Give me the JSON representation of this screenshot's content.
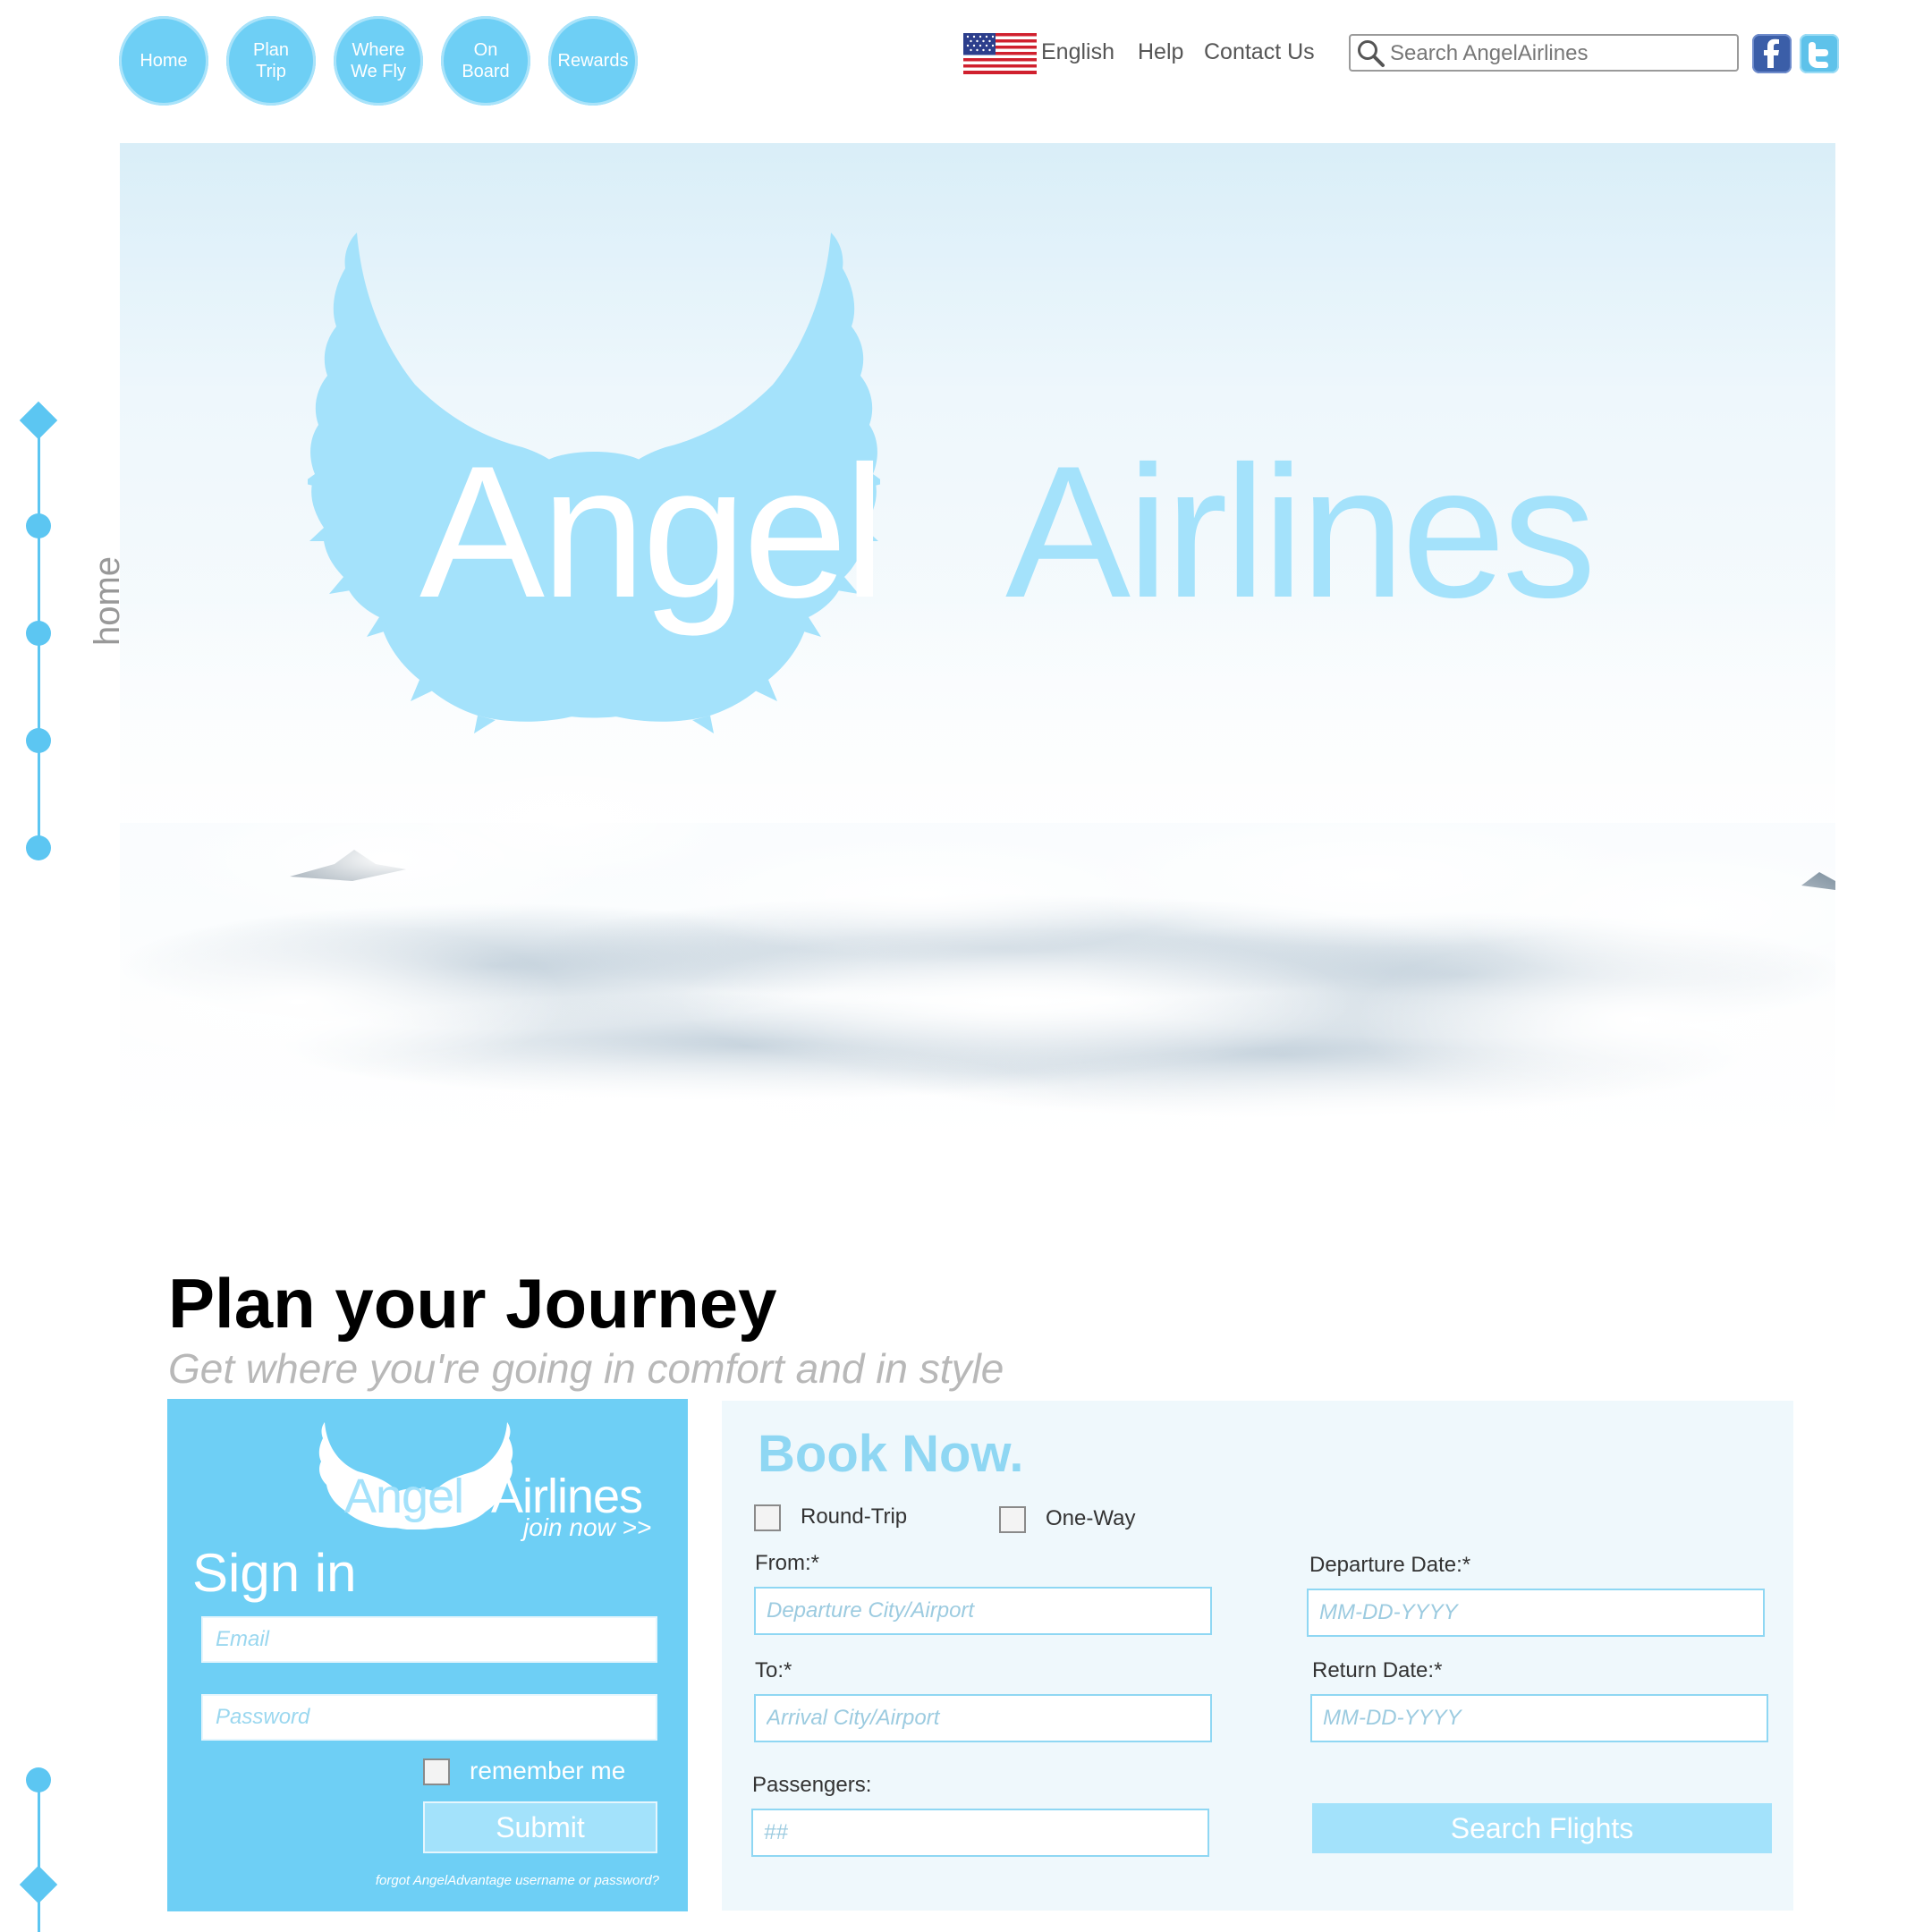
{
  "nav": {
    "items": [
      {
        "line1": "Home",
        "line2": ""
      },
      {
        "line1": "Plan",
        "line2": "Trip"
      },
      {
        "line1": "Where",
        "line2": "We Fly"
      },
      {
        "line1": "On",
        "line2": "Board"
      },
      {
        "line1": "Rewards",
        "line2": ""
      }
    ]
  },
  "utility": {
    "language": "English",
    "help": "Help",
    "contact": "Contact Us",
    "search_placeholder": "Search AngelAirlines"
  },
  "hero": {
    "logo_word_1": "Angel",
    "logo_word_2": "Airlines"
  },
  "side": {
    "section_label": "home"
  },
  "journey": {
    "title": "Plan your Journey",
    "subtitle": "Get where you're going in comfort and in style"
  },
  "signin": {
    "logo_word_1": "Angel",
    "logo_word_2": "Airlines",
    "join_link": "join now >>",
    "title": "Sign in",
    "email_placeholder": "Email",
    "password_placeholder": "Password",
    "remember_label": "remember me",
    "submit_label": "Submit",
    "forgot_link": "forgot AngelAdvantage username or password?"
  },
  "booking": {
    "title": "Book Now.",
    "round_trip_label": "Round-Trip",
    "one_way_label": "One-Way",
    "from_label": "From:*",
    "from_placeholder": "Departure City/Airport",
    "to_label": "To:*",
    "to_placeholder": "Arrival City/Airport",
    "passengers_label": "Passengers:",
    "passengers_placeholder": "##",
    "departure_label": "Departure Date:*",
    "departure_placeholder": "MM-DD-YYYY",
    "return_label": "Return Date:*",
    "return_placeholder": "MM-DD-YYYY",
    "search_label": "Search Flights"
  },
  "colors": {
    "accent": "#6ecff5",
    "accent_light": "#a3e2fb",
    "panel_bg": "#eff8fc",
    "logo_blue": "#a4e2fb"
  },
  "icons": [
    "search-icon",
    "us-flag-icon",
    "facebook-icon",
    "twitter-icon"
  ]
}
